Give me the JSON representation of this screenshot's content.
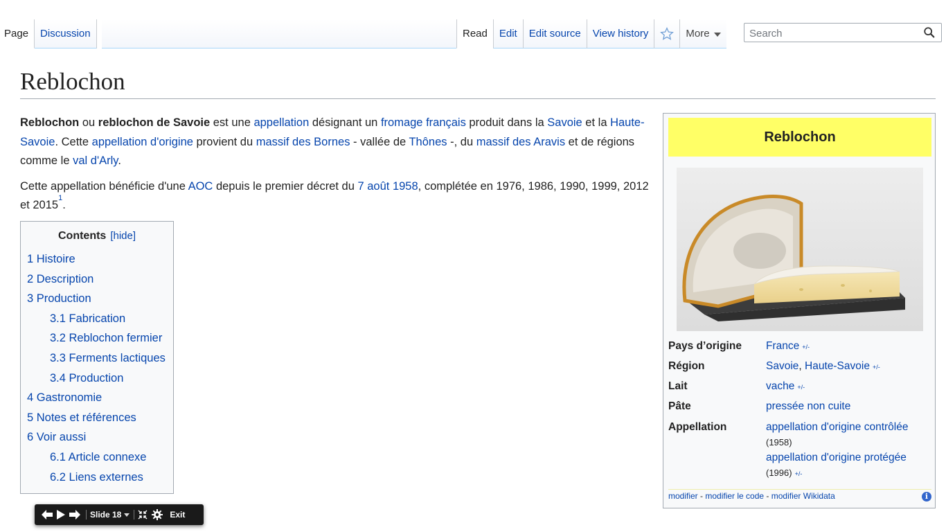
{
  "tabs": {
    "page": "Page",
    "discussion": "Discussion",
    "read": "Read",
    "edit": "Edit",
    "edit_source": "Edit source",
    "view_history": "View history",
    "watch_icon": "star-icon",
    "more": "More"
  },
  "search": {
    "placeholder": "Search",
    "icon": "search-icon"
  },
  "title": "Reblochon",
  "intro": {
    "p1": {
      "b1": "Reblochon",
      "t1": " ou ",
      "b2": "reblochon de Savoie",
      "t2": " est une ",
      "l1": "appellation",
      "t3": " désignant un ",
      "l2": "fromage français",
      "t4": " produit dans la ",
      "l3": "Savoie",
      "t5": " et la ",
      "l4": "Haute-Savoie",
      "t6": ". Cette ",
      "l5": "appellation d'origine",
      "t7": " provient du ",
      "l6": "massif des Bornes",
      "t8": " - vallée de ",
      "l7": "Thônes",
      "t9": " -, du ",
      "l8": "massif des Aravis",
      "t10": " et de régions comme le ",
      "l9": "val d'Arly",
      "t11": "."
    },
    "p2": {
      "t1": "Cette appellation bénéficie d'une ",
      "l1": "AOC",
      "t2": " depuis le premier décret du ",
      "l2": "7 août 1958",
      "t3": ", complétée en 1976, 1986, 1990, 1999, 2012 et 2015",
      "ref": "1",
      "t4": "."
    }
  },
  "toc": {
    "title": "Contents",
    "toggle": "[hide]",
    "items": [
      {
        "label": "1 Histoire",
        "level": 1
      },
      {
        "label": "2 Description",
        "level": 1
      },
      {
        "label": "3 Production",
        "level": 1
      },
      {
        "label": "3.1 Fabrication",
        "level": 2
      },
      {
        "label": "3.2 Reblochon fermier",
        "level": 2
      },
      {
        "label": "3.3 Ferments lactiques",
        "level": 2
      },
      {
        "label": "3.4 Production",
        "level": 2
      },
      {
        "label": "4 Gastronomie",
        "level": 1
      },
      {
        "label": "5 Notes et références",
        "level": 1
      },
      {
        "label": "6 Voir aussi",
        "level": 1
      },
      {
        "label": "6.1 Article connexe",
        "level": 2
      },
      {
        "label": "6.2 Liens externes",
        "level": 2
      }
    ]
  },
  "infobox": {
    "title": "Reblochon",
    "title_bg": "#ffff66",
    "rows": {
      "pays": {
        "label": "Pays d’origine",
        "value": "France",
        "pm": "+/-"
      },
      "region": {
        "label": "Région",
        "v1": "Savoie",
        "sep": ", ",
        "v2": "Haute-Savoie",
        "pm": "+/-"
      },
      "lait": {
        "label": "Lait",
        "value": "vache",
        "pm": "+/-"
      },
      "pate": {
        "label": "Pâte",
        "value": "pressée non cuite"
      },
      "appellation": {
        "label": "Appellation",
        "v1": "appellation d'origine contrôlée",
        "y1": "(1958)",
        "v2": "appellation d'origine protégée",
        "y2": "(1996)",
        "pm": "+/-"
      }
    },
    "footer": {
      "modifier": "modifier",
      "sep1": " - ",
      "modifier_code": "modifier le code",
      "sep2": " - ",
      "modifier_wikidata": "modifier Wikidata",
      "info": "i"
    }
  },
  "slidebar": {
    "slide_label": "Slide 18",
    "exit": "Exit"
  }
}
